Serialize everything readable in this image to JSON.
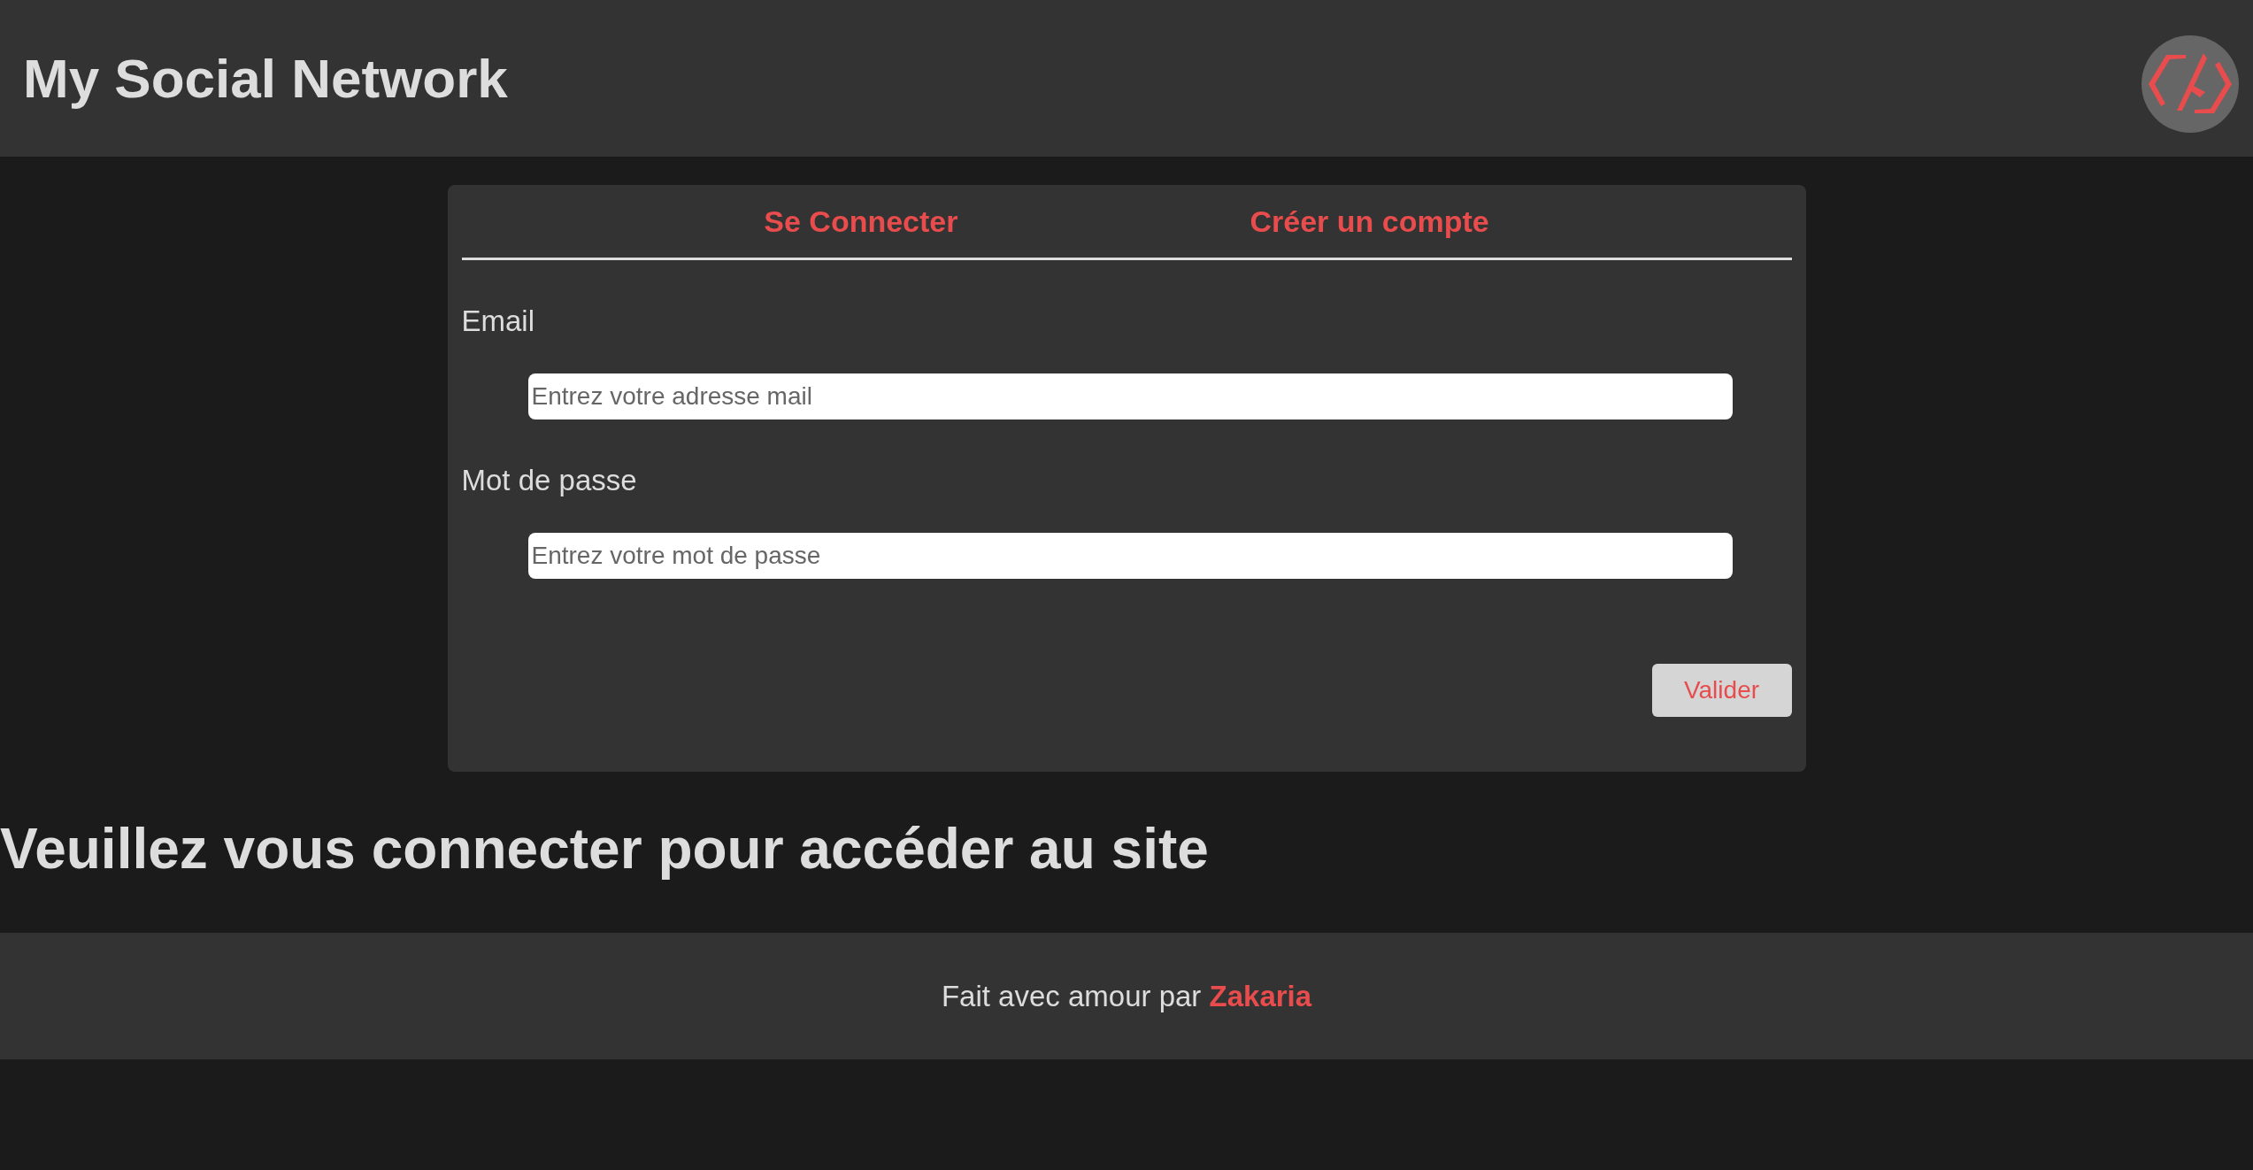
{
  "header": {
    "title": "My Social Network"
  },
  "tabs": [
    {
      "label": "Se Connecter"
    },
    {
      "label": "Créer un compte"
    }
  ],
  "form": {
    "fields": [
      {
        "label": "Email",
        "placeholder": "Entrez votre adresse mail"
      },
      {
        "label": "Mot de passe",
        "placeholder": "Entrez votre mot de passe"
      }
    ],
    "submit": "Valider"
  },
  "message": "Veuillez vous connecter pour accéder au site",
  "footer": {
    "text": "Fait avec amour par **Zakaria**"
  }
}
